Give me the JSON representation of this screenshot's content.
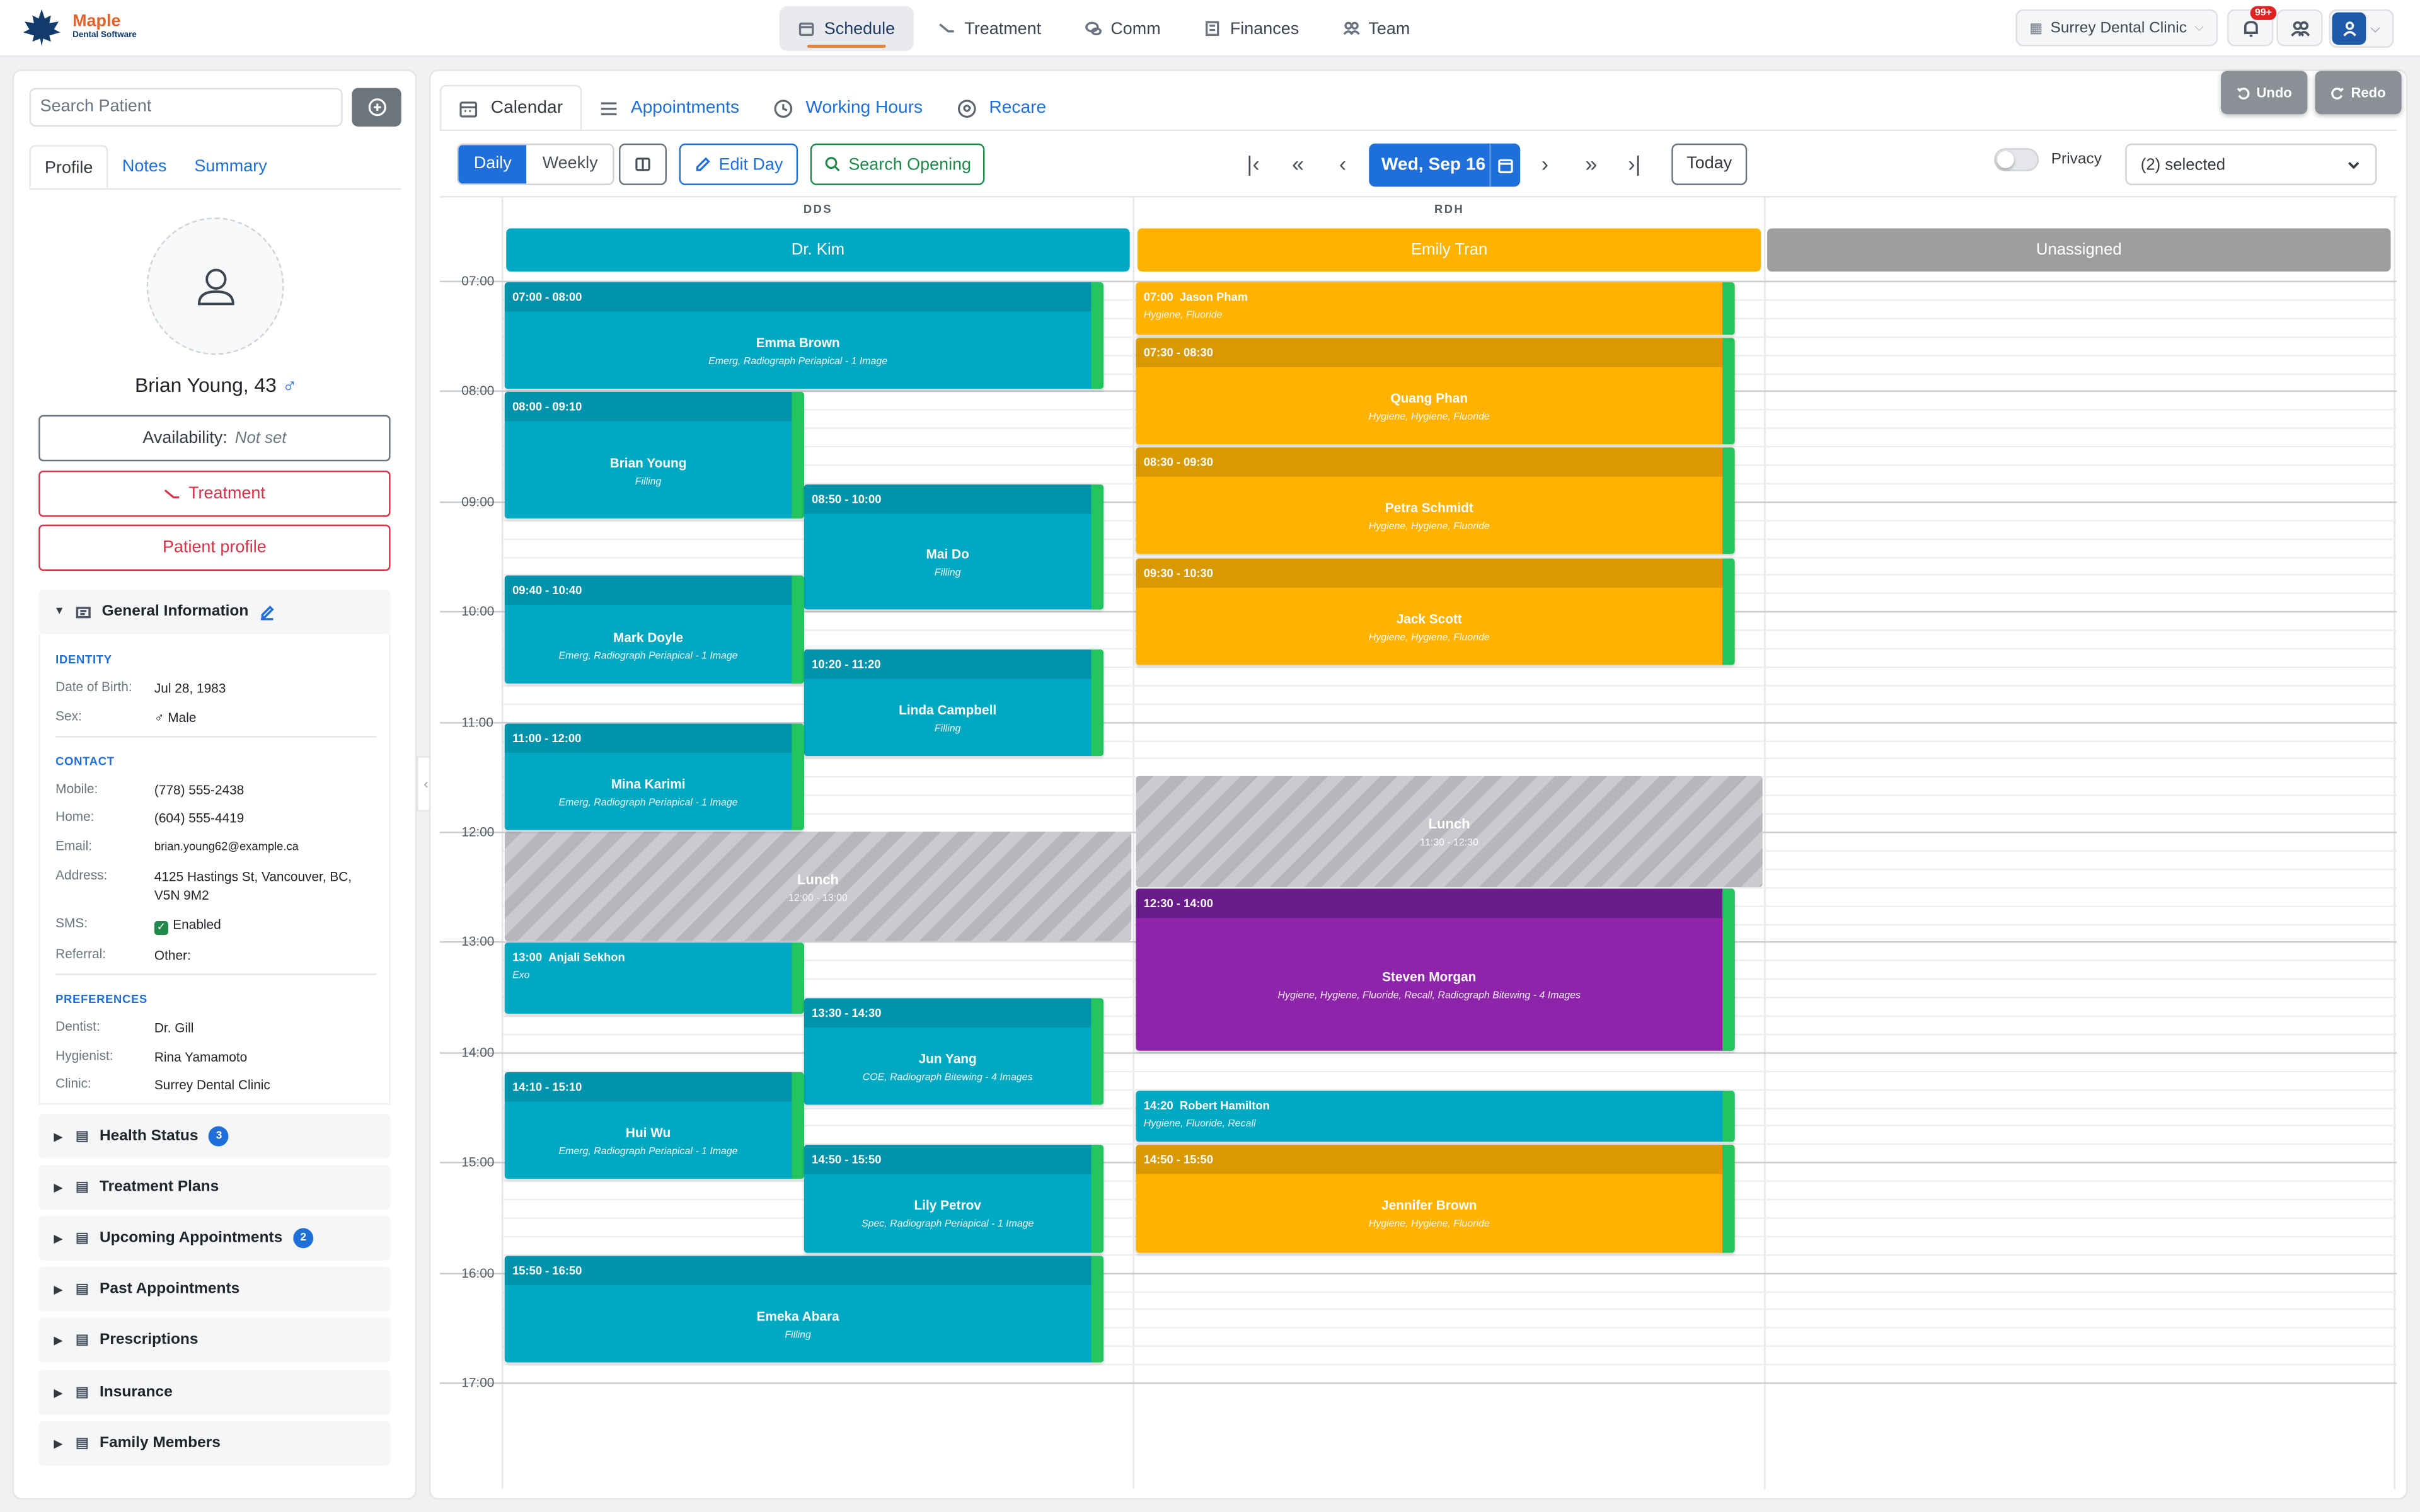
{
  "app": {
    "logo_title": "Maple",
    "logo_subtitle": "Dental Software",
    "nav": [
      {
        "label": "Schedule",
        "icon": "calendar-icon",
        "active": true
      },
      {
        "label": "Treatment",
        "icon": "tooth-tool-icon",
        "active": false
      },
      {
        "label": "Comm",
        "icon": "chat-icon",
        "active": false
      },
      {
        "label": "Finances",
        "icon": "ledger-icon",
        "active": false
      },
      {
        "label": "Team",
        "icon": "team-icon",
        "active": false
      }
    ],
    "clinic": "Surrey Dental Clinic",
    "notification_badge": "99+"
  },
  "patient_panel": {
    "search_placeholder": "Search Patient",
    "tabs": [
      "Profile",
      "Notes",
      "Summary"
    ],
    "active_tab": "Profile",
    "name": "Brian Young, 43",
    "sex_symbol": "♂",
    "availability_label": "Availability:",
    "availability_value": "Not set",
    "treatment_button": "Treatment",
    "profile_button": "Patient profile",
    "general_info_title": "General Information",
    "identity_heading": "IDENTITY",
    "identity": [
      {
        "k": "Date of Birth:",
        "v": "Jul 28, 1983"
      },
      {
        "k": "Sex:",
        "v": "♂ Male"
      }
    ],
    "contact_heading": "CONTACT",
    "contact": [
      {
        "k": "Mobile:",
        "v": "(778) 555-2438"
      },
      {
        "k": "Home:",
        "v": "(604) 555-4419"
      },
      {
        "k": "Email:",
        "v": "brian.young62@example.ca"
      },
      {
        "k": "Address:",
        "v": "4125 Hastings St, Vancouver, BC, V5N 9M2"
      },
      {
        "k": "SMS:",
        "v": "Enabled"
      },
      {
        "k": "Referral:",
        "v": "Other:"
      }
    ],
    "preferences_heading": "PREFERENCES",
    "preferences": [
      {
        "k": "Dentist:",
        "v": "Dr. Gill"
      },
      {
        "k": "Hygienist:",
        "v": "Rina Yamamoto"
      },
      {
        "k": "Clinic:",
        "v": "Surrey Dental Clinic"
      }
    ],
    "sections": [
      {
        "label": "Health Status",
        "count": "3",
        "icon": "clipboard-icon"
      },
      {
        "label": "Treatment Plans",
        "count": "",
        "icon": "tooth-tool-icon"
      },
      {
        "label": "Upcoming Appointments",
        "count": "2",
        "icon": "calendar-icon"
      },
      {
        "label": "Past Appointments",
        "count": "",
        "icon": "history-icon"
      },
      {
        "label": "Prescriptions",
        "count": "",
        "icon": "rx-icon"
      },
      {
        "label": "Insurance",
        "count": "",
        "icon": "card-icon"
      },
      {
        "label": "Family Members",
        "count": "",
        "icon": "family-icon"
      }
    ]
  },
  "schedule": {
    "tabs": [
      {
        "label": "Calendar",
        "icon": "calendar-icon",
        "active": true
      },
      {
        "label": "Appointments",
        "icon": "list-icon",
        "active": false
      },
      {
        "label": "Working Hours",
        "icon": "clock-icon",
        "active": false
      },
      {
        "label": "Recare",
        "icon": "recare-icon",
        "active": false
      }
    ],
    "undo_label": "Undo",
    "redo_label": "Redo",
    "view_daily": "Daily",
    "view_weekly": "Weekly",
    "edit_day": "Edit Day",
    "search_opening": "Search Opening",
    "date_label": "Wed, Sep 16",
    "today_label": "Today",
    "privacy_label": "Privacy",
    "provider_filter": "(2) selected",
    "hours": [
      "07:00",
      "08:00",
      "09:00",
      "10:00",
      "11:00",
      "12:00",
      "13:00",
      "14:00",
      "15:00",
      "16:00",
      "17:00"
    ],
    "columns": [
      {
        "role": "DDS",
        "provider": "Dr. Kim",
        "color": "#00a8c2"
      },
      {
        "role": "RDH",
        "provider": "Emily Tran",
        "color": "#ffb300"
      },
      {
        "role": "",
        "provider": "Unassigned",
        "color": "#9e9e9e"
      }
    ],
    "appointments": [
      {
        "col": 0,
        "sub": 0,
        "span": 2,
        "start": "07:00",
        "end": "08:00",
        "time": "07:00 - 08:00",
        "patient": "Emma Brown",
        "desc": "Emerg, Radiograph Periapical - 1 Image",
        "color": "teal",
        "compact": false
      },
      {
        "col": 0,
        "sub": 0,
        "span": 1,
        "start": "08:00",
        "end": "09:10",
        "time": "08:00 - 09:10",
        "patient": "Brian Young",
        "desc": "Filling",
        "color": "teal",
        "compact": false
      },
      {
        "col": 0,
        "sub": 1,
        "span": 1,
        "start": "08:50",
        "end": "10:00",
        "time": "08:50 - 10:00",
        "patient": "Mai Do",
        "desc": "Filling",
        "color": "teal",
        "compact": false
      },
      {
        "col": 0,
        "sub": 0,
        "span": 1,
        "start": "09:40",
        "end": "10:40",
        "time": "09:40 - 10:40",
        "patient": "Mark Doyle",
        "desc": "Emerg, Radiograph Periapical - 1 Image",
        "color": "teal",
        "compact": false
      },
      {
        "col": 0,
        "sub": 1,
        "span": 1,
        "start": "10:20",
        "end": "11:20",
        "time": "10:20 - 11:20",
        "patient": "Linda Campbell",
        "desc": "Filling",
        "color": "teal",
        "compact": false
      },
      {
        "col": 0,
        "sub": 0,
        "span": 1,
        "start": "11:00",
        "end": "12:00",
        "time": "11:00 - 12:00",
        "patient": "Mina Karimi",
        "desc": "Emerg, Radiograph Periapical - 1 Image",
        "color": "teal",
        "compact": false
      },
      {
        "col": 0,
        "sub": 0,
        "span": 1,
        "start": "13:00",
        "end": "13:40",
        "time": "13:00",
        "patient": "Anjali Sekhon",
        "desc": "Exo",
        "color": "teal",
        "compact": true
      },
      {
        "col": 0,
        "sub": 1,
        "span": 1,
        "start": "13:30",
        "end": "14:30",
        "time": "13:30 - 14:30",
        "patient": "Jun Yang",
        "desc": "COE, Radiograph Bitewing - 4 Images",
        "color": "teal",
        "compact": false
      },
      {
        "col": 0,
        "sub": 0,
        "span": 1,
        "start": "14:10",
        "end": "15:10",
        "time": "14:10 - 15:10",
        "patient": "Hui Wu",
        "desc": "Emerg, Radiograph Periapical - 1 Image",
        "color": "teal",
        "compact": false
      },
      {
        "col": 0,
        "sub": 1,
        "span": 1,
        "start": "14:50",
        "end": "15:50",
        "time": "14:50 - 15:50",
        "patient": "Lily Petrov",
        "desc": "Spec, Radiograph Periapical - 1 Image",
        "color": "teal",
        "compact": false
      },
      {
        "col": 0,
        "sub": 0,
        "span": 2,
        "start": "15:50",
        "end": "16:50",
        "time": "15:50 - 16:50",
        "patient": "Emeka Abara",
        "desc": "Filling",
        "color": "teal",
        "compact": false
      },
      {
        "col": 1,
        "sub": 0,
        "span": 2,
        "start": "07:00",
        "end": "07:30",
        "time": "07:00",
        "patient": "Jason Pham",
        "desc": "Hygiene, Fluoride",
        "color": "amber",
        "compact": true
      },
      {
        "col": 1,
        "sub": 0,
        "span": 2,
        "start": "07:30",
        "end": "08:30",
        "time": "07:30 - 08:30",
        "patient": "Quang Phan",
        "desc": "Hygiene, Hygiene, Fluoride",
        "color": "amber",
        "compact": false
      },
      {
        "col": 1,
        "sub": 0,
        "span": 2,
        "start": "08:30",
        "end": "09:30",
        "time": "08:30 - 09:30",
        "patient": "Petra Schmidt",
        "desc": "Hygiene, Hygiene, Fluoride",
        "color": "amber",
        "compact": false
      },
      {
        "col": 1,
        "sub": 0,
        "span": 2,
        "start": "09:30",
        "end": "10:30",
        "time": "09:30 - 10:30",
        "patient": "Jack Scott",
        "desc": "Hygiene, Hygiene, Fluoride",
        "color": "amber",
        "compact": false
      },
      {
        "col": 1,
        "sub": 0,
        "span": 2,
        "start": "12:30",
        "end": "14:00",
        "time": "12:30 - 14:00",
        "patient": "Steven Morgan",
        "desc": "Hygiene, Hygiene, Fluoride, Recall, Radiograph Bitewing - 4 Images",
        "color": "purple",
        "compact": false
      },
      {
        "col": 1,
        "sub": 0,
        "span": 2,
        "start": "14:20",
        "end": "14:50",
        "time": "14:20",
        "patient": "Robert Hamilton",
        "desc": "Hygiene, Fluoride, Recall",
        "color": "teal",
        "compact": true
      },
      {
        "col": 1,
        "sub": 0,
        "span": 2,
        "start": "14:50",
        "end": "15:50",
        "time": "14:50 - 15:50",
        "patient": "Jennifer Brown",
        "desc": "Hygiene, Hygiene, Fluoride",
        "color": "amber",
        "compact": false
      }
    ],
    "lunches": [
      {
        "col": 0,
        "start": "12:00",
        "end": "13:00",
        "label": "Lunch",
        "time": "12:00 - 13:00"
      },
      {
        "col": 1,
        "start": "11:30",
        "end": "12:30",
        "label": "Lunch",
        "time": "11:30 - 12:30"
      }
    ]
  }
}
